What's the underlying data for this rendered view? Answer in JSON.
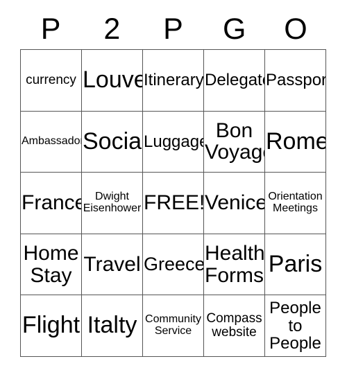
{
  "card": {
    "columns": 5,
    "rows": 5,
    "border_color": "#555555",
    "text_color": "#000000",
    "background_color": "#ffffff",
    "header": {
      "letters": [
        "P",
        "2",
        "P",
        "G",
        "O"
      ]
    },
    "cells": [
      [
        {
          "text": "currency",
          "size": "fs-md"
        },
        {
          "text": "Louve",
          "size": "fs-huge"
        },
        {
          "text": "Itinerary",
          "size": "fs-lg"
        },
        {
          "text": "Delegate",
          "size": "fs-lg"
        },
        {
          "text": "Passport",
          "size": "fs-lg"
        }
      ],
      [
        {
          "text": "Ambassador",
          "size": "fs-sm"
        },
        {
          "text": "Social",
          "size": "fs-huge"
        },
        {
          "text": "Luggage",
          "size": "fs-lg"
        },
        {
          "text": "Bon\nVoyage",
          "size": "fs-xxl"
        },
        {
          "text": "Rome",
          "size": "fs-huge"
        }
      ],
      [
        {
          "text": "France",
          "size": "fs-xxl"
        },
        {
          "text": "Dwight\nEisenhower",
          "size": "fs-sm"
        },
        {
          "text": "FREE!",
          "size": "fs-xxl"
        },
        {
          "text": "Venice",
          "size": "fs-xxl"
        },
        {
          "text": "Orientation\nMeetings",
          "size": "fs-sm"
        }
      ],
      [
        {
          "text": "Home\nStay",
          "size": "fs-xxl"
        },
        {
          "text": "Travel",
          "size": "fs-xxl"
        },
        {
          "text": "Greece",
          "size": "fs-xl"
        },
        {
          "text": "Health\nForms",
          "size": "fs-xxl"
        },
        {
          "text": "Paris",
          "size": "fs-huge"
        }
      ],
      [
        {
          "text": "Flight",
          "size": "fs-huge"
        },
        {
          "text": "Italty",
          "size": "fs-huge"
        },
        {
          "text": "Community\nService",
          "size": "fs-sm"
        },
        {
          "text": "Compass\nwebsite",
          "size": "fs-md"
        },
        {
          "text": "People\nto\nPeople",
          "size": "fs-lg"
        }
      ]
    ]
  }
}
